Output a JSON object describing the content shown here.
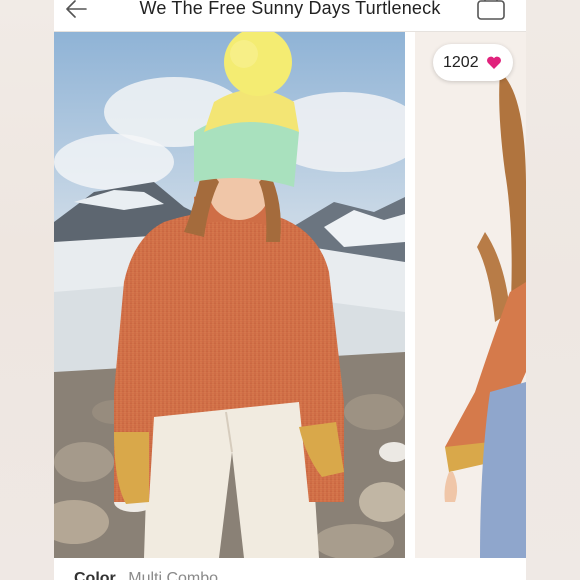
{
  "header": {
    "title": "We The Free Sunny Days Turtleneck",
    "back_icon": "back-arrow-icon",
    "bag_icon": "shopping-bag-icon"
  },
  "likes": {
    "count": "1202",
    "icon": "heart-icon",
    "color": "#e0227c"
  },
  "details": {
    "color_label": "Color",
    "color_value": "Multi Combo"
  }
}
